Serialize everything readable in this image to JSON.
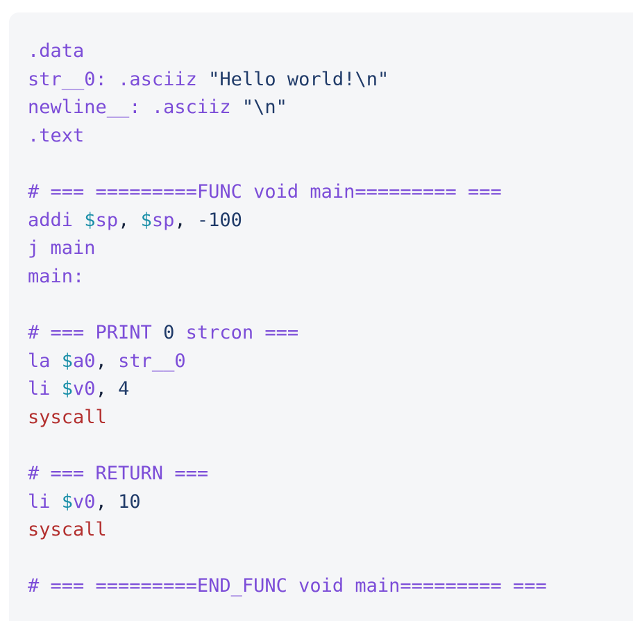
{
  "panel": {
    "background_color": "#f5f6f8",
    "page_background_color": "#ffffff",
    "language": "mips-assembly"
  },
  "theme": {
    "keyword_color": "#7c4dd8",
    "comment_color": "#7c4dd8",
    "sigil_color": "#1a8fa8",
    "number_color": "#1f3a68",
    "string_color": "#1f3a68",
    "punctuation_color": "#16233d",
    "syscall_color": "#b3302f"
  },
  "code": {
    "plain_text": ".data\nstr__0: .asciiz \"Hello world!\\n\"\nnewline__: .asciiz \"\\n\"\n.text\n\n# === =========FUNC void main========= ===\naddi $sp, $sp, -100\nj main\nmain:\n\n# === PRINT 0 strcon ===\nla $a0, str__0\nli $v0, 4\nsyscall\n\n# === RETURN ===\nli $v0, 10\nsyscall\n\n# === =========END_FUNC void main========= ===",
    "lines": [
      {
        "id": "line-1",
        "tokens": [
          {
            "t": ".data",
            "c": "t-kw"
          }
        ]
      },
      {
        "id": "line-2",
        "tokens": [
          {
            "t": "str__0:",
            "c": "t-kw"
          },
          {
            "t": " ",
            "c": "t-pun"
          },
          {
            "t": ".asciiz",
            "c": "t-kw"
          },
          {
            "t": " ",
            "c": "t-pun"
          },
          {
            "t": "\"Hello world!\\n\"",
            "c": "t-str"
          }
        ]
      },
      {
        "id": "line-3",
        "tokens": [
          {
            "t": "newline__:",
            "c": "t-kw"
          },
          {
            "t": " ",
            "c": "t-pun"
          },
          {
            "t": ".asciiz",
            "c": "t-kw"
          },
          {
            "t": " ",
            "c": "t-pun"
          },
          {
            "t": "\"\\n\"",
            "c": "t-str"
          }
        ]
      },
      {
        "id": "line-4",
        "tokens": [
          {
            "t": ".text",
            "c": "t-kw"
          }
        ]
      },
      {
        "id": "line-5",
        "tokens": [
          {
            "t": "",
            "c": "t-pun"
          }
        ]
      },
      {
        "id": "line-6",
        "tokens": [
          {
            "t": "# === =========FUNC void main========= ===",
            "c": "t-cmt"
          }
        ]
      },
      {
        "id": "line-7",
        "tokens": [
          {
            "t": "addi",
            "c": "t-kw"
          },
          {
            "t": " ",
            "c": "t-pun"
          },
          {
            "t": "$",
            "c": "t-sig"
          },
          {
            "t": "sp",
            "c": "t-kw"
          },
          {
            "t": ", ",
            "c": "t-pun"
          },
          {
            "t": "$",
            "c": "t-sig"
          },
          {
            "t": "sp",
            "c": "t-kw"
          },
          {
            "t": ", ",
            "c": "t-pun"
          },
          {
            "t": "-100",
            "c": "t-num"
          }
        ]
      },
      {
        "id": "line-8",
        "tokens": [
          {
            "t": "j",
            "c": "t-kw"
          },
          {
            "t": " ",
            "c": "t-pun"
          },
          {
            "t": "main",
            "c": "t-kw"
          }
        ]
      },
      {
        "id": "line-9",
        "tokens": [
          {
            "t": "main:",
            "c": "t-kw"
          }
        ]
      },
      {
        "id": "line-10",
        "tokens": [
          {
            "t": "",
            "c": "t-pun"
          }
        ]
      },
      {
        "id": "line-11",
        "tokens": [
          {
            "t": "# === PRINT ",
            "c": "t-cmt"
          },
          {
            "t": "0",
            "c": "t-num"
          },
          {
            "t": " strcon ===",
            "c": "t-cmt"
          }
        ]
      },
      {
        "id": "line-12",
        "tokens": [
          {
            "t": "la",
            "c": "t-kw"
          },
          {
            "t": " ",
            "c": "t-pun"
          },
          {
            "t": "$",
            "c": "t-sig"
          },
          {
            "t": "a0",
            "c": "t-kw"
          },
          {
            "t": ", ",
            "c": "t-pun"
          },
          {
            "t": "str__0",
            "c": "t-kw"
          }
        ]
      },
      {
        "id": "line-13",
        "tokens": [
          {
            "t": "li",
            "c": "t-kw"
          },
          {
            "t": " ",
            "c": "t-pun"
          },
          {
            "t": "$",
            "c": "t-sig"
          },
          {
            "t": "v0",
            "c": "t-kw"
          },
          {
            "t": ", ",
            "c": "t-pun"
          },
          {
            "t": "4",
            "c": "t-num"
          }
        ]
      },
      {
        "id": "line-14",
        "tokens": [
          {
            "t": "syscall",
            "c": "t-sys"
          }
        ]
      },
      {
        "id": "line-15",
        "tokens": [
          {
            "t": "",
            "c": "t-pun"
          }
        ]
      },
      {
        "id": "line-16",
        "tokens": [
          {
            "t": "# === RETURN ===",
            "c": "t-cmt"
          }
        ]
      },
      {
        "id": "line-17",
        "tokens": [
          {
            "t": "li",
            "c": "t-kw"
          },
          {
            "t": " ",
            "c": "t-pun"
          },
          {
            "t": "$",
            "c": "t-sig"
          },
          {
            "t": "v0",
            "c": "t-kw"
          },
          {
            "t": ", ",
            "c": "t-pun"
          },
          {
            "t": "10",
            "c": "t-num"
          }
        ]
      },
      {
        "id": "line-18",
        "tokens": [
          {
            "t": "syscall",
            "c": "t-sys"
          }
        ]
      },
      {
        "id": "line-19",
        "tokens": [
          {
            "t": "",
            "c": "t-pun"
          }
        ]
      },
      {
        "id": "line-20",
        "tokens": [
          {
            "t": "# === =========END_FUNC void main========= ===",
            "c": "t-cmt"
          }
        ]
      }
    ]
  }
}
